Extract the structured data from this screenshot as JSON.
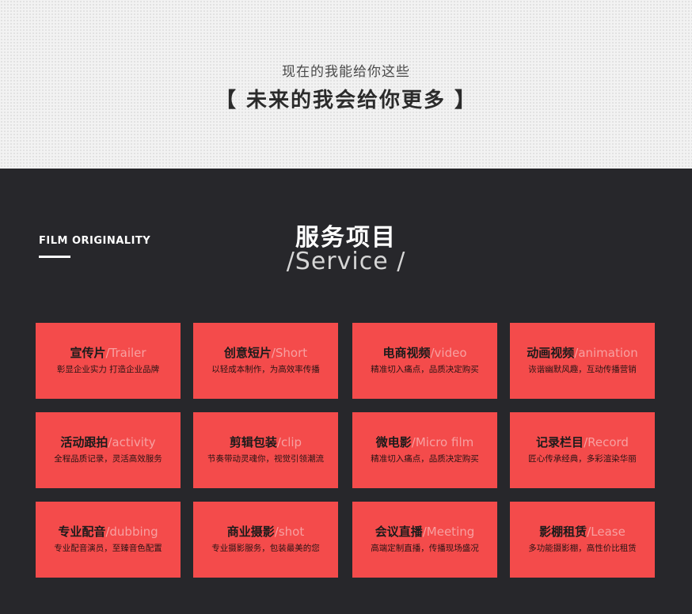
{
  "intro": {
    "subtitle": "现在的我能给你这些",
    "title": "【 未来的我会给你更多 】"
  },
  "section": {
    "brand": "FILM ORIGINALITY",
    "title": "服务项目",
    "subtitle_en": "/Service /"
  },
  "colors": {
    "card_bg": "#f44b4b",
    "dark_bg": "#27272b"
  },
  "services": [
    {
      "cn": "宣传片",
      "en": "/Trailer",
      "desc": "彰显企业实力 打造企业品牌"
    },
    {
      "cn": "创意短片",
      "en": "/Short",
      "desc": "以轻成本制作，为高效率传播"
    },
    {
      "cn": "电商视频",
      "en": "/video",
      "desc": "精准切入痛点，品质决定购买"
    },
    {
      "cn": "动画视频",
      "en": "/animation",
      "desc": "诙谐幽默风趣，互动传播营销"
    },
    {
      "cn": "活动跟拍",
      "en": "/activity",
      "desc": "全程品质记录，灵活高效服务"
    },
    {
      "cn": "剪辑包装",
      "en": "/clip",
      "desc": "节奏带动灵魂你，视觉引领潮流"
    },
    {
      "cn": "微电影",
      "en": "/Micro film",
      "desc": "精准切入痛点，品质决定购买"
    },
    {
      "cn": "记录栏目",
      "en": "/Record",
      "desc": "匠心传承经典，多彩渲染华丽"
    },
    {
      "cn": "专业配音",
      "en": "/dubbing",
      "desc": "专业配音演员，至臻音色配置"
    },
    {
      "cn": "商业摄影",
      "en": "/shot",
      "desc": "专业摄影服务，包装最美的您"
    },
    {
      "cn": "会议直播",
      "en": "/Meeting",
      "desc": "高端定制直播，传播现场盛况"
    },
    {
      "cn": "影棚租赁",
      "en": "/Lease",
      "desc": "多功能摄影棚，高性价比租赁"
    }
  ]
}
